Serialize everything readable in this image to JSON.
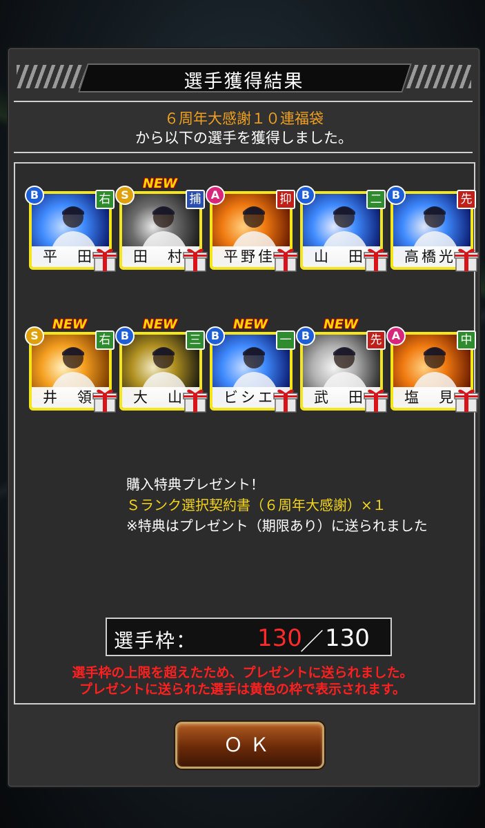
{
  "dialog": {
    "title": "選手獲得結果",
    "subtitle_line1": "６周年大感謝１０連福袋",
    "subtitle_line2": "から以下の選手を獲得しました。"
  },
  "players": [
    {
      "name": "平　田",
      "rank": "B",
      "position": "右",
      "pos_color": "#2e8b2e",
      "is_new": false,
      "new_label": "",
      "art_colors": [
        "#0b1a6e",
        "#3f8bff",
        "#bcd8ff"
      ]
    },
    {
      "name": "田　村",
      "rank": "S",
      "position": "捕",
      "pos_color": "#2a4fb0",
      "is_new": true,
      "new_label": "NEW",
      "art_colors": [
        "#1a1a1a",
        "#6d6d6d",
        "#e8e8e8"
      ]
    },
    {
      "name": "平野佳",
      "rank": "A",
      "position": "抑",
      "pos_color": "#c0201a",
      "is_new": false,
      "new_label": "",
      "art_colors": [
        "#6a1a00",
        "#f07a10",
        "#ffd080"
      ]
    },
    {
      "name": "山　田",
      "rank": "B",
      "position": "二",
      "pos_color": "#2e8b2e",
      "is_new": false,
      "new_label": "",
      "art_colors": [
        "#0b1a6e",
        "#3f8bff",
        "#e0e8ff"
      ]
    },
    {
      "name": "高橋光",
      "rank": "B",
      "position": "先",
      "pos_color": "#c0201a",
      "is_new": false,
      "new_label": "",
      "art_colors": [
        "#0b1a6e",
        "#3f8bff",
        "#dfe6f5"
      ]
    },
    {
      "name": "井　領",
      "rank": "S",
      "position": "右",
      "pos_color": "#2e8b2e",
      "is_new": true,
      "new_label": "NEW",
      "art_colors": [
        "#7a3a00",
        "#f5a020",
        "#fff0c0"
      ]
    },
    {
      "name": "大　山",
      "rank": "B",
      "position": "三",
      "pos_color": "#2e8b2e",
      "is_new": true,
      "new_label": "NEW",
      "art_colors": [
        "#1a1a10",
        "#b09020",
        "#f0e8c0"
      ]
    },
    {
      "name": "ビシエド",
      "rank": "B",
      "position": "一",
      "pos_color": "#2e8b2e",
      "is_new": true,
      "new_label": "NEW",
      "art_colors": [
        "#0b1a6e",
        "#3f8bff",
        "#c0d8ff"
      ]
    },
    {
      "name": "武　田",
      "rank": "B",
      "position": "先",
      "pos_color": "#c0201a",
      "is_new": true,
      "new_label": "NEW",
      "art_colors": [
        "#2a2a2a",
        "#b0b0b0",
        "#f4f4f4"
      ]
    },
    {
      "name": "塩　見",
      "rank": "A",
      "position": "中",
      "pos_color": "#2e8b2e",
      "is_new": false,
      "new_label": "",
      "art_colors": [
        "#6a1a00",
        "#f07a10",
        "#ffd080"
      ]
    }
  ],
  "bonus": {
    "line1": "購入特典プレゼント！",
    "line2": "Ｓランク選択契約書（６周年大感謝）×１",
    "line3": "※特典はプレゼント（期限あり）に送られました"
  },
  "slots": {
    "label": "選手枠：",
    "current": "130",
    "separator": "／",
    "max": "130"
  },
  "warning": {
    "line1": "選手枠の上限を超えたため、プレゼントに送られました。",
    "line2": "プレゼントに送られた選手は黄色の枠で表示されます。"
  },
  "ok_button": "ＯＫ"
}
